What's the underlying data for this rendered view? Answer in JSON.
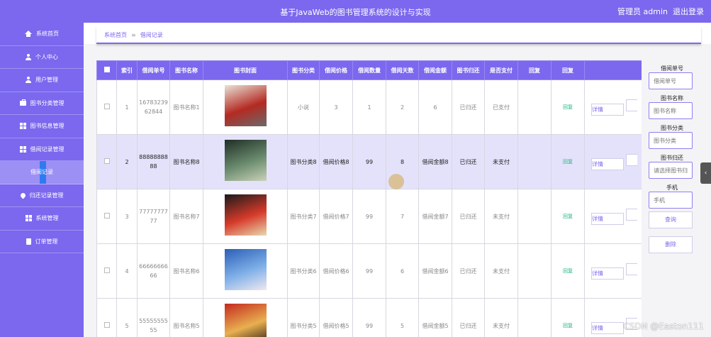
{
  "header": {
    "title": "基于JavaWeb的图书管理系统的设计与实现",
    "user": "管理员 admin",
    "logout": "退出登录"
  },
  "sidebar": {
    "items": [
      {
        "label": "系统首页",
        "icon": "home-icon",
        "sub": false
      },
      {
        "label": "个人中心",
        "icon": "user-icon",
        "sub": false
      },
      {
        "label": "用户管理",
        "icon": "user-icon",
        "sub": false
      },
      {
        "label": "图书分类管理",
        "icon": "briefcase-icon",
        "sub": false
      },
      {
        "label": "图书信息管理",
        "icon": "grid-icon",
        "sub": false
      },
      {
        "label": "借阅记录管理",
        "icon": "grid-icon",
        "sub": false
      },
      {
        "label": "借阅记录",
        "icon": "",
        "sub": true
      },
      {
        "label": "归还记录管理",
        "icon": "pin-icon",
        "sub": false
      },
      {
        "label": "系统管理",
        "icon": "grid-icon",
        "sub": false
      },
      {
        "label": "订单管理",
        "icon": "clipboard-icon",
        "sub": false
      }
    ]
  },
  "breadcrumb": {
    "home": "系统首页",
    "sep": "≡",
    "current": "借阅记录"
  },
  "table": {
    "headers": [
      "索引",
      "借阅单号",
      "图书名称",
      "图书封面",
      "图书分类",
      "借阅价格",
      "借阅数量",
      "借阅天数",
      "借阅金额",
      "图书归还",
      "是否支付",
      "回复",
      "回复"
    ],
    "detail_label": "详情",
    "rows": [
      {
        "index": "1",
        "no": "1678323962844",
        "name": "图书名称1",
        "category": "小说",
        "price": "3",
        "qty": "1",
        "days": "2",
        "amount": "6",
        "returned": "已归还",
        "paid": "已支付",
        "reply": "",
        "ret": "回复",
        "cover_colors": [
          "#e9e2d7",
          "#b42a22",
          "#6a6a6a"
        ],
        "highlight": false
      },
      {
        "index": "2",
        "no": "8888888888",
        "name": "图书名称8",
        "category": "图书分类8",
        "price": "借阅价格8",
        "qty": "99",
        "days": "8",
        "amount": "借阅金额8",
        "returned": "已归还",
        "paid": "未支付",
        "reply": "",
        "ret": "回复",
        "cover_colors": [
          "#1f2e25",
          "#6a8b6e",
          "#c9d1b8"
        ],
        "highlight": true
      },
      {
        "index": "3",
        "no": "7777777777",
        "name": "图书名称7",
        "category": "图书分类7",
        "price": "借阅价格7",
        "qty": "99",
        "days": "7",
        "amount": "借阅金额7",
        "returned": "已归还",
        "paid": "未支付",
        "reply": "",
        "ret": "回复",
        "cover_colors": [
          "#1a1a1a",
          "#d63a2a",
          "#e8d9b0"
        ],
        "highlight": false
      },
      {
        "index": "4",
        "no": "6666666666",
        "name": "图书名称6",
        "category": "图书分类6",
        "price": "借阅价格6",
        "qty": "99",
        "days": "6",
        "amount": "借阅金额6",
        "returned": "已归还",
        "paid": "未支付",
        "reply": "",
        "ret": "回复",
        "cover_colors": [
          "#2c5fb8",
          "#7fb0e8",
          "#f0e8f0"
        ],
        "highlight": false
      },
      {
        "index": "5",
        "no": "5555555555",
        "name": "图书名称5",
        "category": "图书分类5",
        "price": "借阅价格5",
        "qty": "99",
        "days": "5",
        "amount": "借阅金额5",
        "returned": "已归还",
        "paid": "未支付",
        "reply": "",
        "ret": "回复",
        "cover_colors": [
          "#c42a1e",
          "#e8b050",
          "#2a1a14"
        ],
        "highlight": false
      }
    ]
  },
  "filter": {
    "no_label": "借阅单号",
    "no_placeholder": "借阅单号",
    "name_label": "图书名称",
    "name_placeholder": "图书名称",
    "cat_label": "图书分类",
    "cat_placeholder": "图书分类",
    "ret_label": "图书归还",
    "ret_placeholder": "请选择图书归",
    "phone_label": "手机",
    "phone_placeholder": "手机",
    "search": "查询",
    "delete": "删除"
  },
  "watermark": "CSDN @Easton111"
}
